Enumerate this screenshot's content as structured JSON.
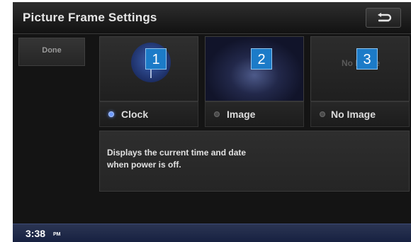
{
  "header": {
    "title": "Picture Frame Settings",
    "back_icon": "return-arrow-icon"
  },
  "done_button": {
    "label": "Done"
  },
  "options": [
    {
      "label": "Clock",
      "badge": "1",
      "selected": true,
      "thumb_icon": "clock-icon"
    },
    {
      "label": "Image",
      "badge": "2",
      "selected": false,
      "thumb_icon": "image-icon"
    },
    {
      "label": "No Image",
      "badge": "3",
      "selected": false,
      "thumb_text": "No Image"
    }
  ],
  "description": {
    "line1": "Displays the current time and date",
    "line2": "when power is off."
  },
  "status_bar": {
    "time": "3:38",
    "ampm": "PM"
  },
  "colors": {
    "accent_badge": "#1c7bc8",
    "radio_selected": "#6f9bff",
    "status_bar": "#1f2a4a"
  }
}
